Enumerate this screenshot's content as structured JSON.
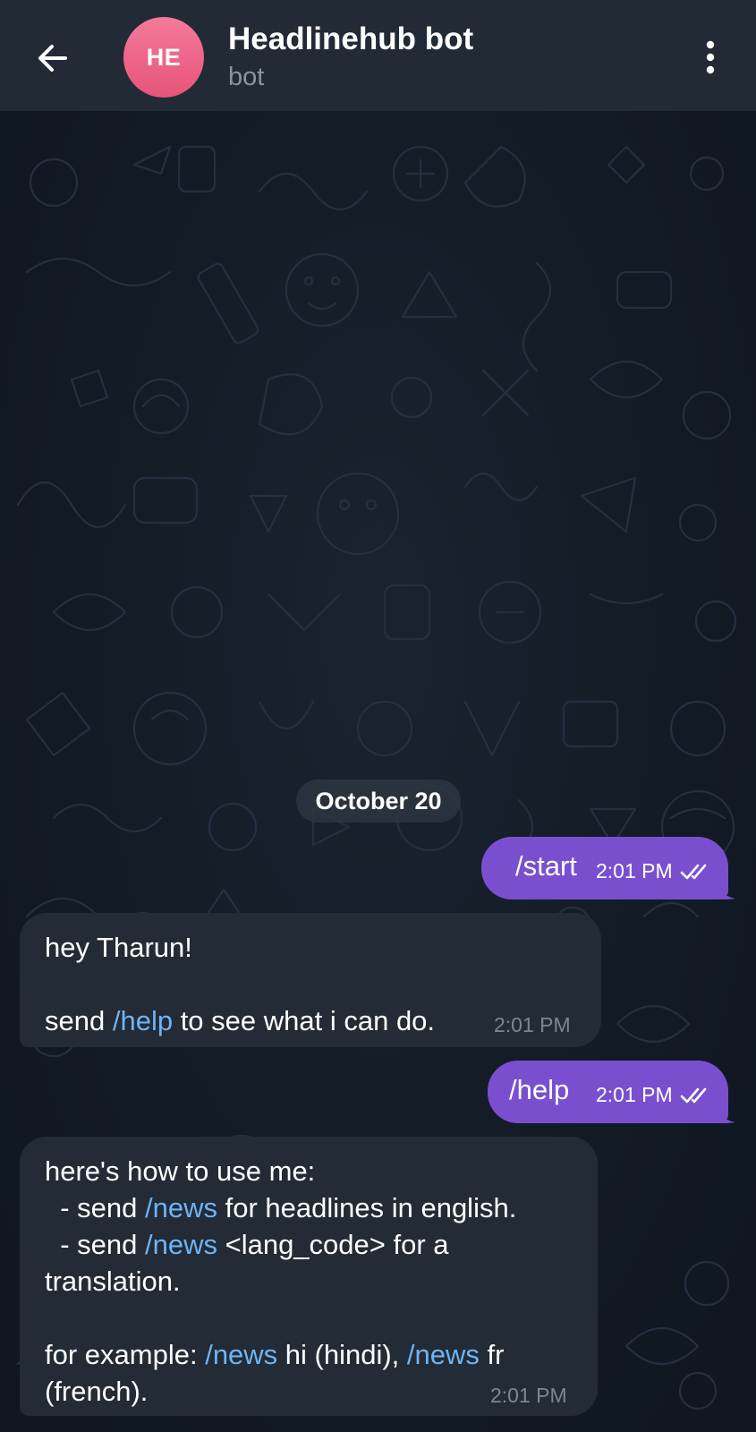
{
  "header": {
    "back_icon": "arrow-left-icon",
    "avatar_initials": "HE",
    "avatar_color": "#e9587f",
    "title": "Headlinehub bot",
    "subtitle": "bot",
    "menu_icon": "more-vertical-icon"
  },
  "date_separator": "October 20",
  "messages": [
    {
      "direction": "outgoing",
      "text": "/start",
      "time": "2:01 PM",
      "status_icon": "double-check-icon"
    },
    {
      "direction": "incoming",
      "line1": "hey Tharun!",
      "line2_prefix": "send ",
      "line2_command": "/help",
      "line2_suffix": " to see what i can do.",
      "time": "2:01 PM"
    },
    {
      "direction": "outgoing",
      "text": "/help",
      "time": "2:01 PM",
      "status_icon": "double-check-icon"
    },
    {
      "direction": "incoming",
      "line1": "here's how to use me:",
      "line2_prefix": "  - send ",
      "line2_command": "/news",
      "line2_suffix": " for headlines in english.",
      "line3_prefix": "  - send ",
      "line3_command": "/news",
      "line3_suffix": " <lang_code> for a",
      "line4": "translation.",
      "line5_prefix": "for example: ",
      "line5_command1": "/news",
      "line5_mid": " hi (hindi), ",
      "line5_command2": "/news",
      "line5_suffix": " fr",
      "line6": "(french).",
      "time": "2:01 PM"
    }
  ],
  "colors": {
    "header_bg": "#222a36",
    "outgoing_bubble": "#7a4fcf",
    "incoming_bubble": "#222b36",
    "command_link": "#6fb3f5",
    "timestamp_incoming": "#7d8794"
  }
}
